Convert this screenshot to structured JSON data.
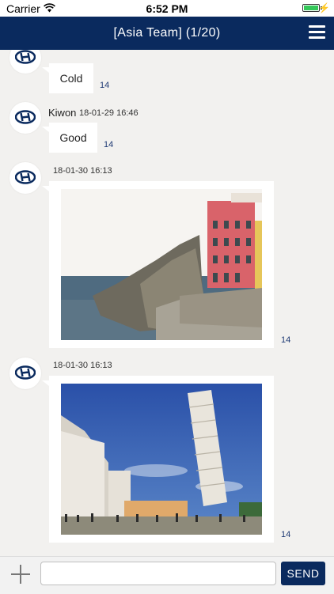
{
  "status_bar": {
    "carrier": "Carrier",
    "time": "6:52 PM",
    "battery_level": 1.0
  },
  "header": {
    "title": "[Asia Team] (1/20)"
  },
  "messages": [
    {
      "type": "text",
      "text": "Cold",
      "count": "14"
    },
    {
      "type": "text",
      "sender": "Kiwon",
      "timestamp": "18-01-29 16:46",
      "text": "Good",
      "count": "14"
    },
    {
      "type": "image",
      "timestamp": "18-01-30 16:13",
      "image": "coastal-village-photo",
      "count": "14"
    },
    {
      "type": "image",
      "timestamp": "18-01-30 16:13",
      "image": "leaning-tower-photo",
      "count": "14"
    }
  ],
  "composer": {
    "value": "",
    "placeholder": "",
    "send_label": "SEND"
  },
  "colors": {
    "nav": "#0a2a5e",
    "background": "#f2f1ef",
    "bubble": "#ffffff",
    "count_text": "#1e3a74"
  }
}
